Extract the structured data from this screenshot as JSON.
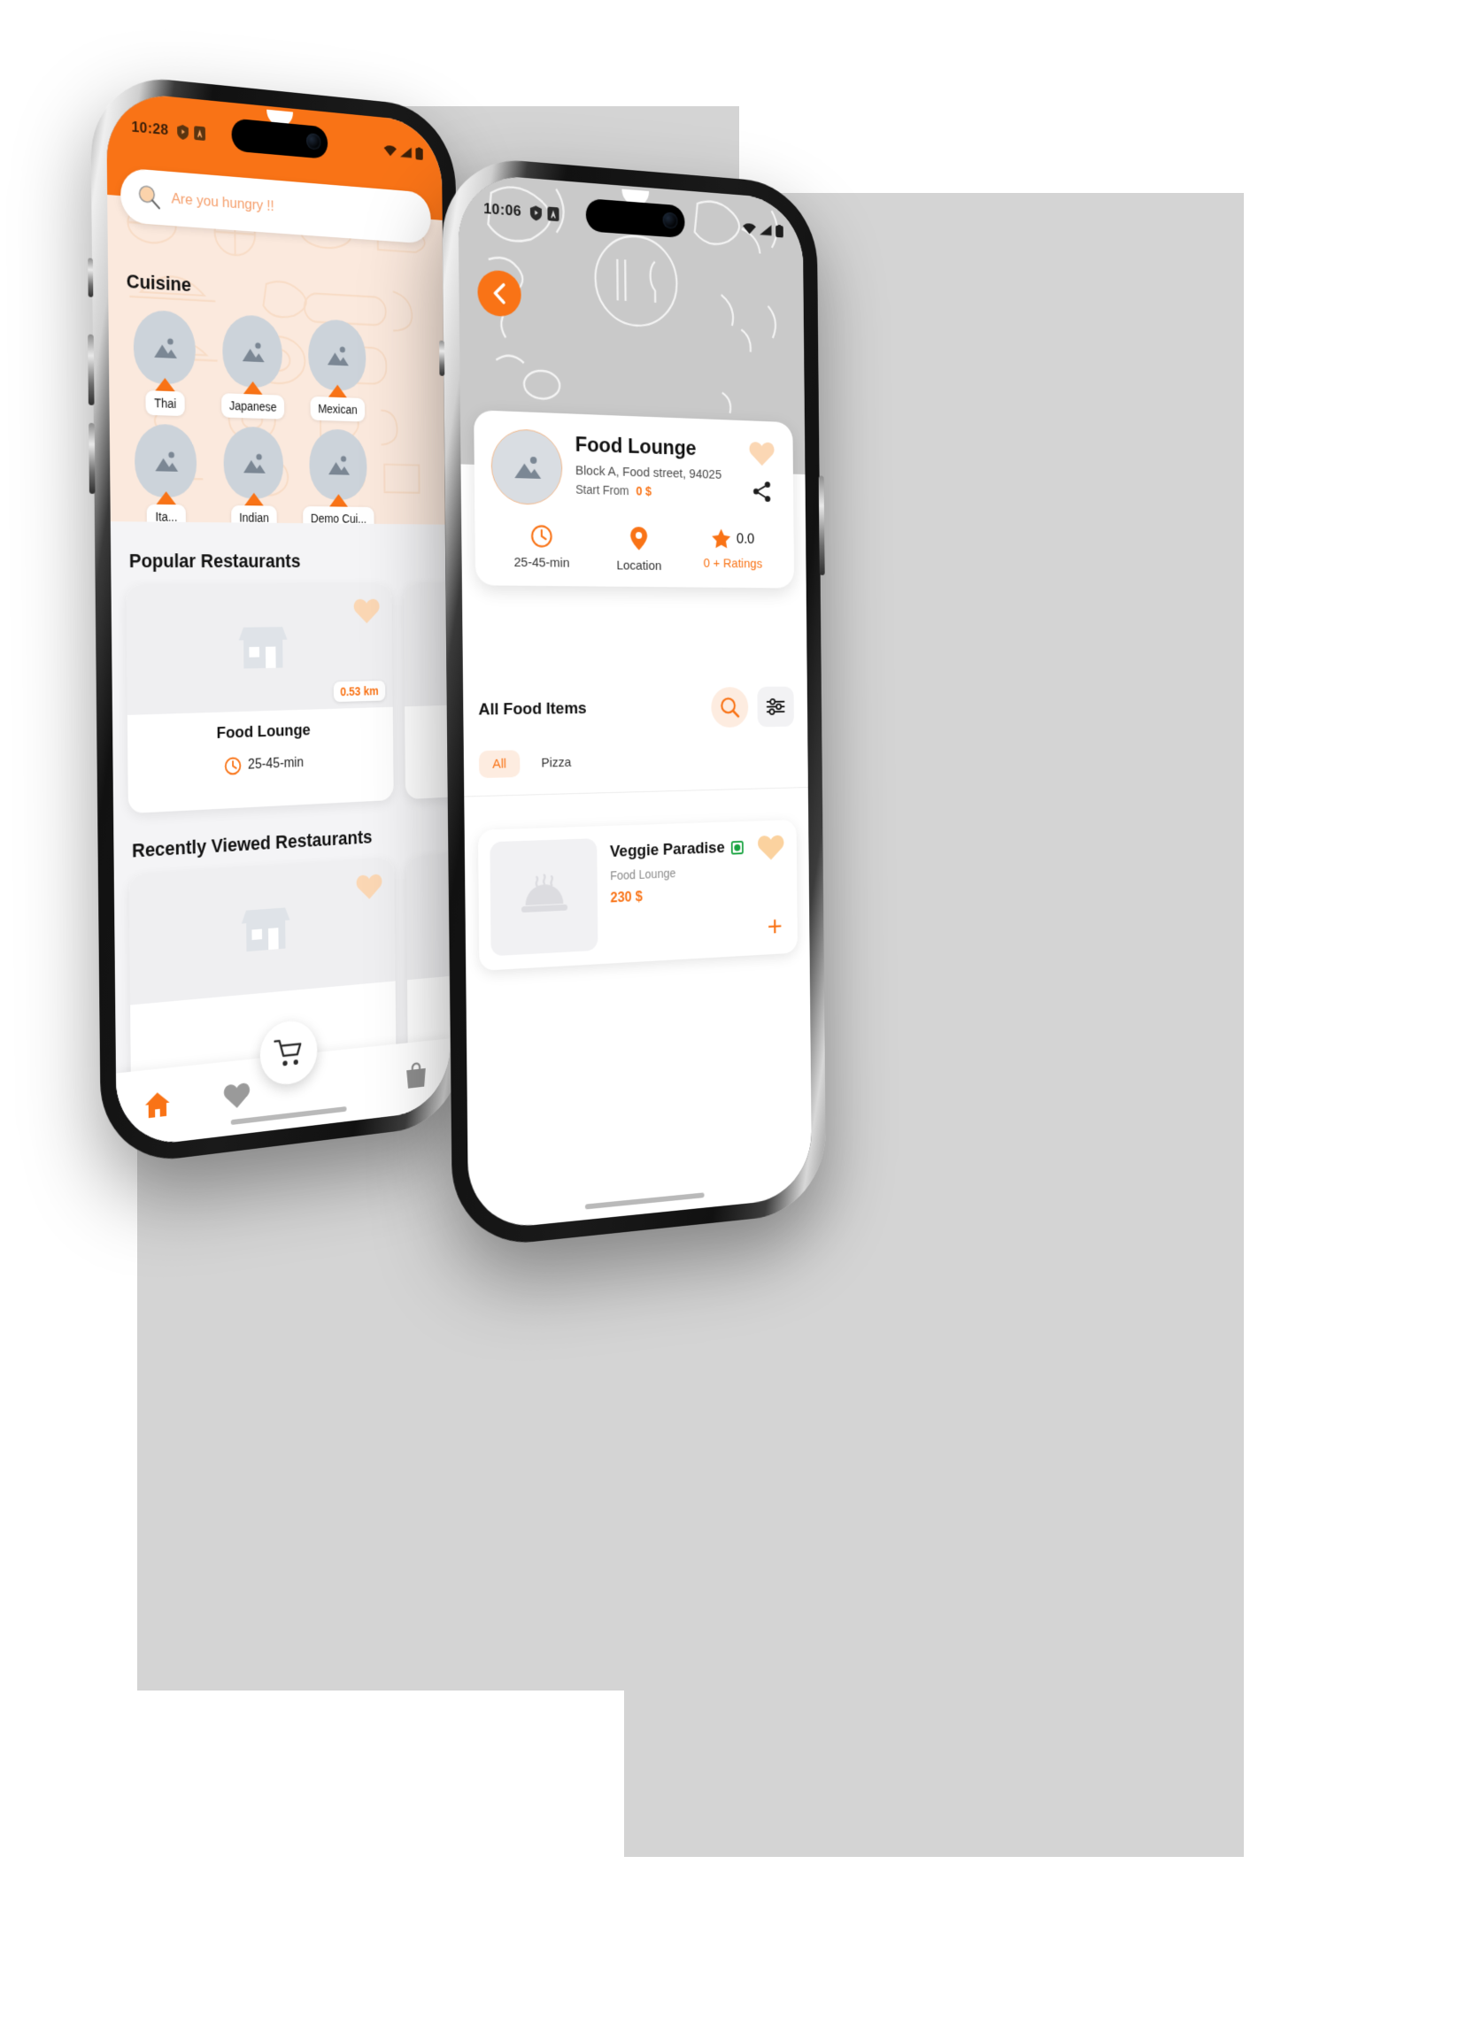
{
  "left_phone": {
    "status_bar": {
      "time": "10:28",
      "icons": [
        "shield-play-icon",
        "app-letter-icon",
        "wifi-icon",
        "signal-icon",
        "battery-icon"
      ]
    },
    "search": {
      "placeholder": "Are you hungry !!",
      "icon": "search-icon"
    },
    "cuisine": {
      "title": "Cuisine",
      "items": [
        {
          "label": "Thai"
        },
        {
          "label": "Japanese"
        },
        {
          "label": "Mexican"
        },
        {
          "label": "Ita..."
        },
        {
          "label": "Indian"
        },
        {
          "label": "Demo Cui..."
        }
      ]
    },
    "popular": {
      "title": "Popular Restaurants",
      "cards": [
        {
          "name": "Food Lounge",
          "distance": "0.53 km",
          "time": "25-45-min",
          "favorite": true
        },
        {
          "name": "",
          "distance": "",
          "time": "",
          "favorite": true
        }
      ]
    },
    "recently_viewed": {
      "title": "Recently Viewed Restaurants",
      "cards": [
        {
          "name": "",
          "distance": "",
          "time": "",
          "favorite": true
        },
        {
          "name": "",
          "distance": "",
          "time": "",
          "favorite": true
        }
      ]
    },
    "tabbar": {
      "items": [
        {
          "name": "home-tab",
          "icon": "home-icon",
          "active": true
        },
        {
          "name": "favorites-tab",
          "icon": "heart-icon",
          "active": false
        },
        {
          "name": "orders-tab",
          "icon": "bag-icon",
          "active": false
        }
      ],
      "fab": {
        "icon": "cart-icon"
      }
    }
  },
  "right_phone": {
    "status_bar": {
      "time": "10:06",
      "icons": [
        "shield-play-icon",
        "app-letter-icon",
        "wifi-icon",
        "signal-icon",
        "battery-icon"
      ]
    },
    "back_button": {
      "icon": "chevron-left-icon"
    },
    "restaurant": {
      "name": "Food Lounge",
      "address": "Block A, Food street, 94025",
      "start_from_label": "Start From",
      "start_from_value": "0 $",
      "favorite_icon": "heart-icon",
      "share_icon": "share-icon",
      "stats": [
        {
          "icon": "clock-icon",
          "label": "25-45-min",
          "value": ""
        },
        {
          "icon": "location-pin-icon",
          "label": "Location",
          "value": ""
        },
        {
          "icon": "star-icon",
          "label": "0 + Ratings",
          "value": "0.0"
        }
      ]
    },
    "all_food": {
      "title": "All Food Items",
      "search_icon": "search-icon",
      "filter_icon": "filter-sliders-icon",
      "chips": [
        {
          "label": "All",
          "active": true
        },
        {
          "label": "Pizza",
          "active": false
        }
      ]
    },
    "food_items": [
      {
        "name": "Veggie Paradise",
        "veg_mark": true,
        "restaurant": "Food Lounge",
        "price": "230 $",
        "favorite_icon": "heart-icon",
        "add_icon": "plus-icon"
      }
    ]
  },
  "colors": {
    "accent": "#f97316",
    "cuisine_bg": "#fbe9dd",
    "page_bg": "#f4f4f6",
    "hero_grey": "#c9c9c9"
  }
}
